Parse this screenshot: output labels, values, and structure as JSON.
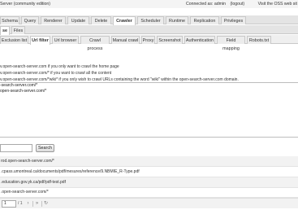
{
  "title": {
    "app": "Server (community edition)",
    "connection": "Connected as: admin",
    "logout": "(logout)",
    "visit": "Visit the OSS web sit"
  },
  "main_tabs": [
    {
      "label": "Schema"
    },
    {
      "label": "Query"
    },
    {
      "label": "Renderer"
    },
    {
      "label": "Update"
    },
    {
      "label": "Delete"
    },
    {
      "label": "Crawler"
    },
    {
      "label": "Scheduler"
    },
    {
      "label": "Runtime"
    },
    {
      "label": "Replication"
    },
    {
      "label": "Privileges"
    }
  ],
  "sub_tabs": [
    {
      "label": "se"
    },
    {
      "label": "Files"
    }
  ],
  "sub_sub_tabs": [
    {
      "label": "Exclusion list"
    },
    {
      "label": "Url filter"
    },
    {
      "label": "Url browser"
    },
    {
      "label": "Crawl process"
    },
    {
      "label": "Manual crawl"
    },
    {
      "label": "Proxy"
    },
    {
      "label": "Screenshot"
    },
    {
      "label": "Authentication"
    },
    {
      "label": "Field mapping"
    },
    {
      "label": "Robots.txt"
    }
  ],
  "hints": [
    "v.open-search-server.com if you only want to crawl the home page",
    "v.open-search-server.com/* if you want to crawl all the content",
    "v.open-search-server.com/*wiki* if you only wish to crawl URLs containing the word \"wiki\" within the open-search-server.com domain."
  ],
  "patterns": [
    "-search-server.com/*",
    "open-search-server.com/*"
  ],
  "search": {
    "button_label": "Search",
    "value": ""
  },
  "url_list": [
    "rod.open-search-server.com/*",
    ".cpass.umontreal.ca/documents/pdf/mesures/reference/9.NBMIE_R-Type.pdf",
    ".education.gov.yk.ca/pdf/pdf-test.pdf",
    ".open-search-server.com/*"
  ],
  "pager": {
    "page": "1",
    "of_text": "/ 1"
  },
  "colors": {
    "tab_bg": "#ececec",
    "tab_active_bg": "#ffffff",
    "row_alt_bg": "#f2f2f2",
    "border": "#c9c9c9"
  }
}
